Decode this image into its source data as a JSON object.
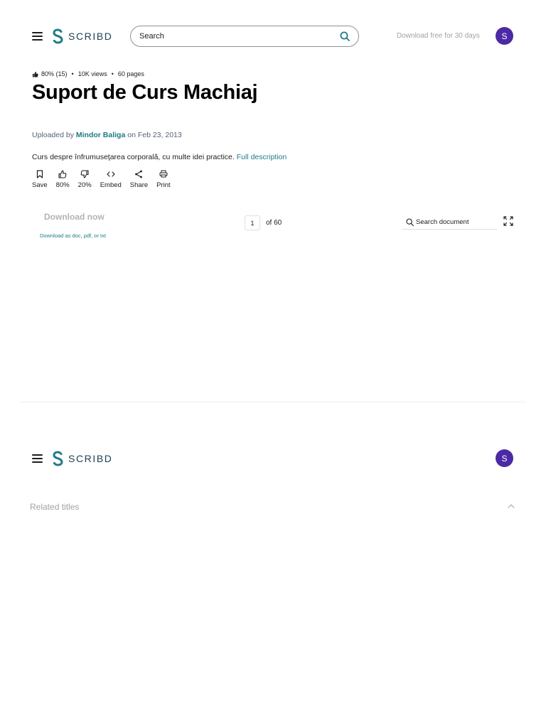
{
  "header": {
    "logo_text": "SCRIBD",
    "search_placeholder": "Search",
    "download_free": "Download free for 30 days",
    "avatar_initial": "S"
  },
  "document": {
    "rating": "80% (15)",
    "views": "10K views",
    "pages": "60 pages",
    "title": "Suport de Curs Machiaj",
    "uploaded_prefix": "Uploaded by",
    "uploader": "Mindor Baliga",
    "uploaded_suffix": "on Feb 23, 2013",
    "description": "Curs despre înfrumuseţarea corporală, cu multe idei practice.",
    "full_description_link": "Full description"
  },
  "actions": [
    {
      "label": "Save",
      "icon": "bookmark-icon"
    },
    {
      "label": "80%",
      "icon": "thumbs-up-icon"
    },
    {
      "label": "20%",
      "icon": "thumbs-down-icon"
    },
    {
      "label": "Embed",
      "icon": "code-icon"
    },
    {
      "label": "Share",
      "icon": "share-icon"
    },
    {
      "label": "Print",
      "icon": "print-icon"
    }
  ],
  "viewer": {
    "download_now": "Download now",
    "download_formats": "Download as doc, pdf, or txt",
    "current_page": "1",
    "page_total": "of 60",
    "search_placeholder": "Search document"
  },
  "bottom": {
    "logo_text": "SCRIBD",
    "avatar_initial": "S",
    "related_titles": "Related titles"
  },
  "colors": {
    "accent_teal": "#1e7b85",
    "avatar_purple": "#4c2aa5",
    "logo_navy": "#1e4155"
  }
}
